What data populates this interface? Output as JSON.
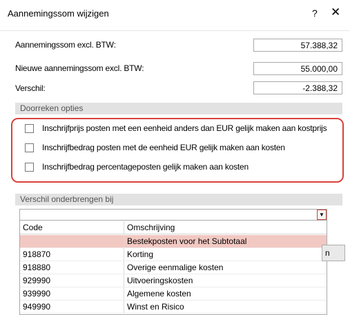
{
  "window": {
    "title": "Aannemingssom wijzigen",
    "help_glyph": "?",
    "close_glyph": "✕"
  },
  "fields": {
    "excl_label": "Aannemingssom excl. BTW:",
    "excl_value": "57.388,32",
    "new_label": "Nieuwe aannemingssom excl. BTW:",
    "new_value": "55.000,00",
    "diff_label": "Verschil:",
    "diff_value": "-2.388,32"
  },
  "options": {
    "header": "Doorreken opties",
    "items": [
      "Inschrijfprijs posten met een eenheid anders dan EUR gelijk maken aan kostprijs",
      "Inschrijfbedrag posten met de eenheid EUR gelijk maken aan kosten",
      "Inschrijfbedrag percentageposten gelijk maken aan kosten"
    ]
  },
  "difference": {
    "header": "Verschil onderbrengen bij",
    "combo_value": "",
    "columns": [
      "Code",
      "Omschrijving"
    ],
    "rows": [
      {
        "code": "",
        "desc": "Bestekposten voor het Subtotaal"
      },
      {
        "code": "918870",
        "desc": "Korting"
      },
      {
        "code": "918880",
        "desc": "Overige eenmalige kosten"
      },
      {
        "code": "929990",
        "desc": "Uitvoeringskosten"
      },
      {
        "code": "939990",
        "desc": "Algemene kosten"
      },
      {
        "code": "949990",
        "desc": "Winst en Risico"
      }
    ]
  },
  "background_button": {
    "label": "n"
  },
  "colors": {
    "highlight": "#d9413b",
    "selected_row": "#f2c8c2"
  }
}
